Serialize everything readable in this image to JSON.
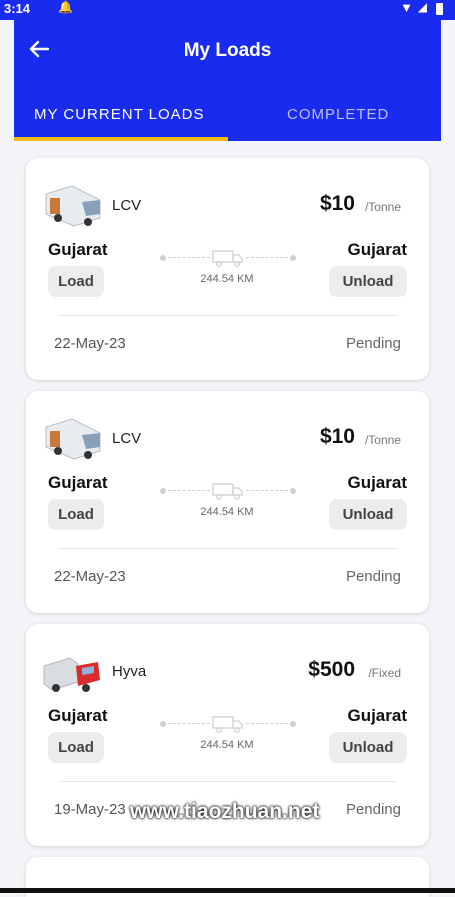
{
  "status_bar": {
    "time": "3:14"
  },
  "header": {
    "title": "My Loads",
    "tabs": [
      {
        "label": "MY CURRENT LOADS"
      },
      {
        "label": "COMPLETED"
      }
    ]
  },
  "loads": [
    {
      "vehicle": "LCV",
      "price": "$10",
      "unit": "/Tonne",
      "from": "Gujarat",
      "to": "Gujarat",
      "load_label": "Load",
      "unload_label": "Unload",
      "distance": "244.54 KM",
      "date": "22-May-23",
      "status": "Pending",
      "icon": "white-van-icon"
    },
    {
      "vehicle": "LCV",
      "price": "$10",
      "unit": "/Tonne",
      "from": "Gujarat",
      "to": "Gujarat",
      "load_label": "Load",
      "unload_label": "Unload",
      "distance": "244.54 KM",
      "date": "22-May-23",
      "status": "Pending",
      "icon": "white-van-icon"
    },
    {
      "vehicle": "Hyva",
      "price": "$500",
      "unit": "/Fixed",
      "from": "Gujarat",
      "to": "Gujarat",
      "load_label": "Load",
      "unload_label": "Unload",
      "distance": "244.54 KM",
      "date": "19-May-23",
      "status": "Pending",
      "icon": "red-truck-icon"
    }
  ],
  "watermark": "www.tiaozhuan.net",
  "colors": {
    "header": "#1a2bf0",
    "tab_indicator": "#f2b81c",
    "background": "#f4f5f8",
    "card": "#ffffff"
  }
}
